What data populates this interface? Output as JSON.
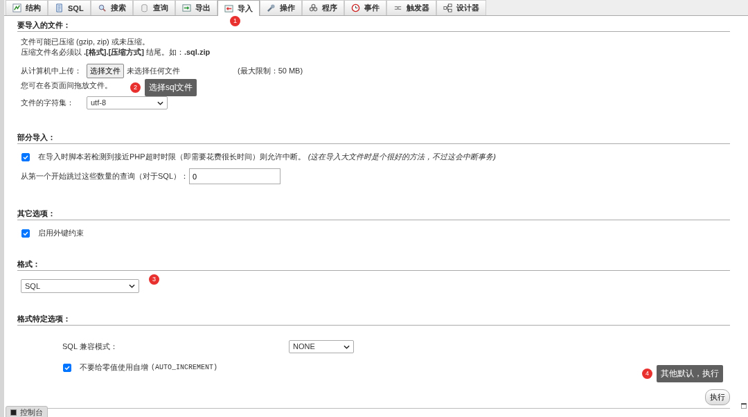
{
  "tabs": [
    {
      "label": "结构",
      "selected": false
    },
    {
      "label": "SQL",
      "selected": false
    },
    {
      "label": "搜索",
      "selected": false
    },
    {
      "label": "查询",
      "selected": false
    },
    {
      "label": "导出",
      "selected": false
    },
    {
      "label": "导入",
      "selected": true
    },
    {
      "label": "操作",
      "selected": false
    },
    {
      "label": "程序",
      "selected": false
    },
    {
      "label": "事件",
      "selected": false
    },
    {
      "label": "触发器",
      "selected": false
    },
    {
      "label": "设计器",
      "selected": false
    }
  ],
  "import_file": {
    "heading": "要导入的文件：",
    "note_1": "文件可能已压缩 (gzip, zip) 或未压缩。",
    "note_2": "压缩文件名必须以 **.[格式].[压缩方式]** 结尾。如：**.sql.zip**",
    "upload_label": "从计算机中上传：",
    "choose_button": "选择文件",
    "no_file": "未选择任何文件",
    "max_size": "(最大限制：50 MB)",
    "drag_note": "您可在各页面间拖放文件。",
    "charset_label": "文件的字符集：",
    "charset_value": "utf-8"
  },
  "partial_import": {
    "heading": "部分导入：",
    "allow_interrupt": {
      "checked": true,
      "label": "在导入时脚本若检测到接近PHP超时时限（即需要花费很长时间）则允许中断。",
      "hint": "(这在导入大文件时是个很好的方法，不过这会中断事务)"
    },
    "skip_label": "从第一个开始跳过这些数量的查询（对于SQL）：",
    "skip_value": "0"
  },
  "other_options": {
    "heading": "其它选项：",
    "foreign_keys": {
      "checked": true,
      "label": "启用外键约束"
    }
  },
  "format": {
    "heading": "格式：",
    "value": "SQL"
  },
  "format_options": {
    "heading": "格式特定选项：",
    "compat_label": "SQL 兼容模式：",
    "compat_value": "NONE",
    "no_auto_value": {
      "checked": true,
      "label": "不要给零值使用自增",
      "code": "(AUTO_INCREMENT)"
    }
  },
  "go_button": "执行",
  "console_tab": "控制台",
  "annotations": [
    {
      "number": "1"
    },
    {
      "number": "2",
      "tooltip": "选择sql文件"
    },
    {
      "number": "3"
    },
    {
      "number": "4",
      "tooltip": "其他默认，执行"
    }
  ]
}
